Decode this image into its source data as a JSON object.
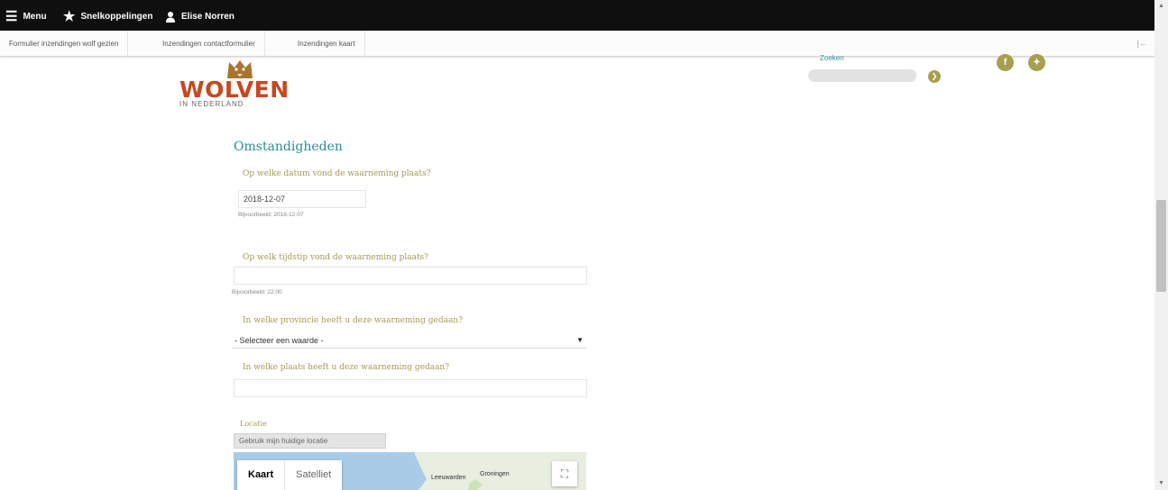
{
  "toolbar": {
    "menu": "Menu",
    "shortcuts": "Snelkoppelingen",
    "user": "Elise Norren"
  },
  "tray": {
    "links": [
      "Formulier inzendingen wolf gezien",
      "Inzendingen contactformulier",
      "Inzendingen kaart"
    ],
    "toggle": "|←"
  },
  "header": {
    "logo_text": "WOLVEN",
    "logo_subtitle": "IN NEDERLAND",
    "search_label": "Zoeken",
    "search_placeholder": "",
    "colors": {
      "logo": "#c8481f",
      "accent": "#a6a04e",
      "teal": "#2c8c99"
    }
  },
  "form": {
    "section_title": "Omstandigheden",
    "date_question": "Op welke datum vond de waarneming plaats?",
    "date_value": "2018-12-07",
    "date_help": "Bijvoorbeeld: 2018-12-07",
    "time_question": "Op welk tijdstip vond de waarneming plaats?",
    "time_value": "",
    "time_help": "Bijvoorbeeld: 22:00",
    "province_question": "In welke provincie heeft u deze waarneming gedaan?",
    "province_selected": "- Selecteer een waarde -",
    "place_question": "In welke plaats heeft u deze waarneming gedaan?",
    "place_value": "",
    "location_label": "Locatie",
    "location_button": "Gebruik mijn huidige locatie"
  },
  "map": {
    "type_map": "Kaart",
    "type_satellite": "Satelliet",
    "cities": [
      "Leeuwarden",
      "Groningen"
    ]
  }
}
